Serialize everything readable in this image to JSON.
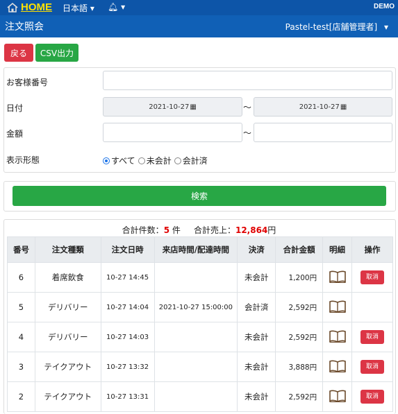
{
  "topbar": {
    "home_label": "HOME",
    "language": "日本語",
    "demo_label": "DEMO"
  },
  "titlebar": {
    "title": "注文照会",
    "user": "Pastel-test[店舗管理者]"
  },
  "toolbar": {
    "back_label": "戻る",
    "csv_label": "CSV出力"
  },
  "form": {
    "customer_label": "お客様番号",
    "customer_value": "",
    "date_label": "日付",
    "date_from": "2021-10-27",
    "date_to": "2021-10-27",
    "amount_label": "金額",
    "amount_from": "",
    "amount_to": "",
    "tilde": "～",
    "display_label": "表示形態",
    "display_options": [
      "すべて",
      "未会計",
      "会計済"
    ],
    "display_selected": "すべて"
  },
  "search": {
    "label": "検索"
  },
  "summary": {
    "count_label": "合計件数：",
    "count_value": "5",
    "count_unit": "件",
    "sales_label": "合計売上：",
    "sales_value": "12,864",
    "sales_unit": "円"
  },
  "table": {
    "headers": [
      "番号",
      "注文種類",
      "注文日時",
      "来店時間/配達時間",
      "決済",
      "合計金額",
      "明細",
      "操作"
    ],
    "cancel_label": "取消",
    "rows": [
      {
        "no": "6",
        "type": "着席飲食",
        "datetime": "10-27 14:45",
        "visit": "",
        "payment": "未会計",
        "total": "1,200円",
        "cancel": true
      },
      {
        "no": "5",
        "type": "デリバリー",
        "datetime": "10-27 14:04",
        "visit": "2021-10-27 15:00:00",
        "payment": "会計済",
        "total": "2,592円",
        "cancel": false
      },
      {
        "no": "4",
        "type": "デリバリー",
        "datetime": "10-27 14:03",
        "visit": "",
        "payment": "未会計",
        "total": "2,592円",
        "cancel": true
      },
      {
        "no": "3",
        "type": "テイクアウト",
        "datetime": "10-27 13:32",
        "visit": "",
        "payment": "未会計",
        "total": "3,888円",
        "cancel": true
      },
      {
        "no": "2",
        "type": "テイクアウト",
        "datetime": "10-27 13:31",
        "visit": "",
        "payment": "未会計",
        "total": "2,592円",
        "cancel": true
      }
    ]
  },
  "colors": {
    "topbar": "#0d55a8",
    "titlebar": "#1060b6",
    "danger": "#dc3545",
    "success": "#28a745",
    "home_accent": "#ffe100",
    "summary_accent": "#e00000"
  },
  "icons": [
    "house-icon",
    "caret-down-icon",
    "bell-icon",
    "calendar-icon",
    "book-icon"
  ]
}
